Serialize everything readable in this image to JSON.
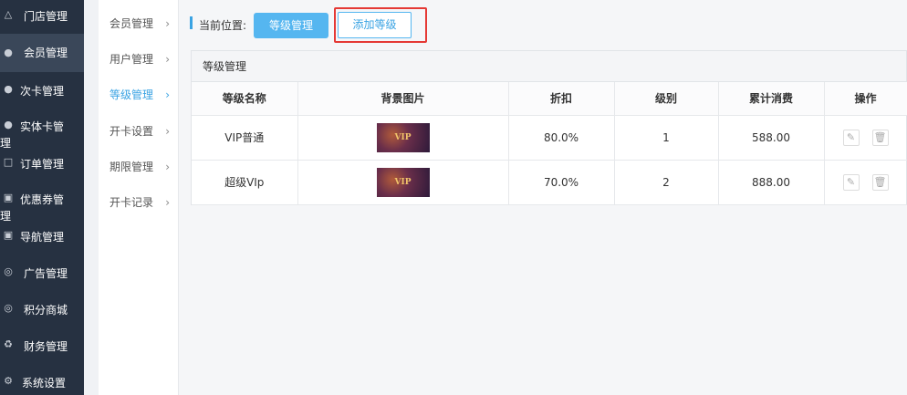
{
  "sidebar": {
    "items": [
      {
        "label": "门店管理",
        "icon": "bank-icon"
      },
      {
        "label": "会员管理",
        "icon": "user-icon",
        "active": true
      },
      {
        "label": "次卡管理",
        "icon": "user-icon"
      },
      {
        "label": "实体卡管理",
        "icon": "user-icon"
      },
      {
        "label": "订单管理",
        "icon": "document-icon"
      },
      {
        "label": "优惠券管理",
        "icon": "coupon-icon"
      },
      {
        "label": "导航管理",
        "icon": "coupon-icon"
      },
      {
        "label": "广告管理",
        "icon": "lifebuoy-icon"
      },
      {
        "label": "积分商城",
        "icon": "lifebuoy-icon"
      },
      {
        "label": "财务管理",
        "icon": "recycle-icon"
      },
      {
        "label": "系统设置",
        "icon": "gear-icon"
      }
    ]
  },
  "submenu": {
    "items": [
      {
        "label": "会员管理"
      },
      {
        "label": "用户管理"
      },
      {
        "label": "等级管理",
        "active": true
      },
      {
        "label": "开卡设置"
      },
      {
        "label": "期限管理"
      },
      {
        "label": "开卡记录"
      }
    ]
  },
  "breadcrumb": {
    "label": "当前位置:",
    "current": "等级管理",
    "add_button": "添加等级"
  },
  "panel": {
    "title": "等级管理",
    "columns": [
      "等级名称",
      "背景图片",
      "折扣",
      "级别",
      "累计消费",
      "操作"
    ],
    "rows": [
      {
        "name": "VIP普通",
        "image_text": "VIP",
        "discount": "80.0%",
        "level": "1",
        "spend": "588.00"
      },
      {
        "name": "超级VIp",
        "image_text": "VIP",
        "discount": "70.0%",
        "level": "2",
        "spend": "888.00"
      }
    ]
  },
  "colors": {
    "accent": "#55b6f0",
    "sidebar_bg": "#263141",
    "highlight": "#e53935"
  }
}
